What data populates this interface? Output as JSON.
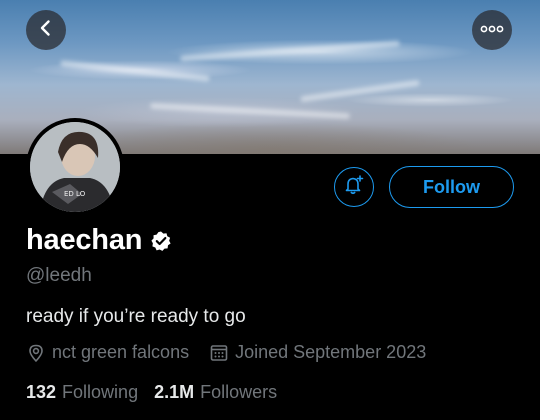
{
  "header": {
    "back_icon": "chevron-left-icon",
    "more_icon": "more-horizontal-icon"
  },
  "profile": {
    "display_name": "haechan",
    "handle": "@leedh",
    "bio": "ready if you’re ready to go",
    "location": "nct green falcons",
    "joined": "Joined September 2023",
    "verified": true
  },
  "actions": {
    "notify_icon": "bell-plus-icon",
    "follow_label": "Follow"
  },
  "stats": {
    "following_count": "132",
    "following_label": "Following",
    "followers_count": "2.1M",
    "followers_label": "Followers"
  },
  "colors": {
    "accent": "#1d9bf0",
    "background": "#000000",
    "muted_text": "#71767b",
    "primary_text": "#e7e9ea"
  }
}
